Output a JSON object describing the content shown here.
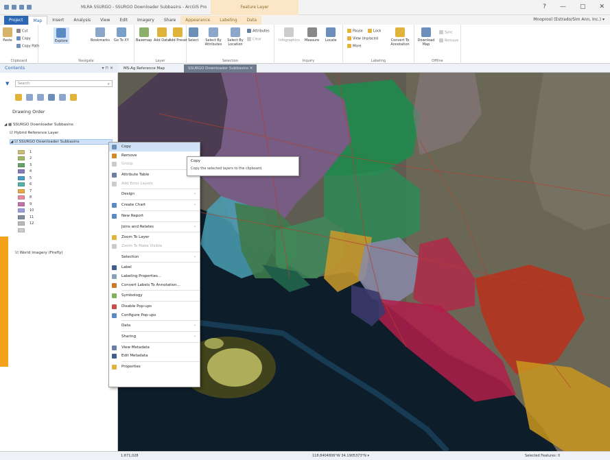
{
  "app": {
    "title": "MLRA SSURGO - SSURGO Downloader Subbasins - ArcGIS Pro",
    "contextual_tab_group": "Feature Layer",
    "window_controls": [
      "?",
      "—",
      "▢",
      "✕"
    ],
    "user": "Mnoprool (Estrado/Sim Ann, Inc.) ▾"
  },
  "ribbon_tabs": [
    "Project",
    "Map",
    "Insert",
    "Analysis",
    "View",
    "Edit",
    "Imagery",
    "Share",
    "Appearance",
    "Labeling",
    "Data"
  ],
  "ribbon": {
    "clipboard": {
      "label": "Clipboard",
      "paste": "Paste",
      "cut": "Cut",
      "copy": "Copy",
      "copy_path": "Copy Path"
    },
    "navigate": {
      "label": "Navigate",
      "explore": "Explore",
      "bookmarks": "Bookmarks",
      "goto": "Go To XY"
    },
    "layer": {
      "label": "Layer",
      "basemap": "Basemap",
      "add_data": "Add Data",
      "add_preset": "Add Preset"
    },
    "selection": {
      "label": "Selection",
      "select": "Select",
      "by_attributes": "Select By Attributes",
      "by_location": "Select By Location",
      "attributes": "Attributes",
      "clear": "Clear"
    },
    "inquiry": {
      "label": "Inquiry",
      "infographics": "Infographics",
      "measure": "Measure",
      "locate": "Locate"
    },
    "labeling": {
      "label": "Labeling",
      "pause": "Pause",
      "lock": "Lock",
      "view_unplaced": "View Unplaced",
      "more": "More",
      "convert": "Convert To Annotation"
    },
    "offline": {
      "label": "Offline",
      "download": "Download Map",
      "sync": "Sync",
      "remove": "Remove"
    }
  },
  "contents": {
    "title": "Contents",
    "controls": "▾ ⊓ ✕",
    "search_placeholder": "Search",
    "heading": "Drawing Order",
    "map_name": "SSURGO Downloader Subbasins",
    "hybrid_layer": "Hybrid Reference Layer",
    "selected_layer": "SSURGO Downloader Subbasins",
    "legend": [
      {
        "label": "1",
        "color": "#c9bd7a"
      },
      {
        "label": "2",
        "color": "#a3b869"
      },
      {
        "label": "3",
        "color": "#67a36b"
      },
      {
        "label": "4",
        "color": "#8b7ab8"
      },
      {
        "label": "5",
        "color": "#4a9cc6"
      },
      {
        "label": "6",
        "color": "#56b0a8"
      },
      {
        "label": "7",
        "color": "#e8a94a"
      },
      {
        "label": "8",
        "color": "#e58aa2"
      },
      {
        "label": "9",
        "color": "#c273a8"
      },
      {
        "label": "10",
        "color": "#9aa0d6"
      },
      {
        "label": "11",
        "color": "#7f8f9c"
      },
      {
        "label": "12",
        "color": "#b9b9b9"
      },
      {
        "label": "",
        "color": "#cccccc"
      }
    ],
    "imagery_layer": "World Imagery (Firefly)"
  },
  "map_tabs": [
    "MS-Ag Reference Map",
    "SSURGO Downloader Subbasins ✕"
  ],
  "context_menu": [
    {
      "label": "Copy",
      "icon": "copy-icon",
      "color": "#6b8fb8"
    },
    {
      "label": "Remove",
      "icon": "remove-icon",
      "color": "#d08a2a"
    },
    {
      "label": "Group",
      "icon": "group-icon",
      "color": "#cccccc"
    },
    {
      "sep": true
    },
    {
      "label": "Attribute Table",
      "icon": "table-icon",
      "color": "#6b7fa3"
    },
    {
      "label": "Add Error Layers",
      "icon": "error-layers-icon",
      "color": "#cccccc"
    },
    {
      "sep": true
    },
    {
      "label": "Design",
      "icon": "",
      "color": "",
      "arrow": true
    },
    {
      "sep": true
    },
    {
      "label": "Create Chart",
      "icon": "chart-icon",
      "color": "#5b8ac2",
      "arrow": true
    },
    {
      "sep": true
    },
    {
      "label": "New Report",
      "icon": "report-icon",
      "color": "#5b8ac2"
    },
    {
      "sep": true
    },
    {
      "label": "Joins and Relates",
      "icon": "",
      "color": "",
      "arrow": true
    },
    {
      "sep": true
    },
    {
      "label": "Zoom To Layer",
      "icon": "zoom-layer-icon",
      "color": "#e0b43c"
    },
    {
      "label": "Zoom To Make Visible",
      "icon": "zoom-visible-icon",
      "color": "#cccccc"
    },
    {
      "sep": true
    },
    {
      "label": "Selection",
      "icon": "",
      "color": "",
      "arrow": true
    },
    {
      "sep": true
    },
    {
      "label": "Label",
      "icon": "label-icon",
      "color": "#3f5f8a"
    },
    {
      "label": "Labeling Properties...",
      "icon": "labeling-props-icon",
      "color": "#8a9fb8"
    },
    {
      "label": "Convert Labels To Annotation...",
      "icon": "convert-labels-icon",
      "color": "#c87a2a"
    },
    {
      "sep": true
    },
    {
      "label": "Symbology",
      "icon": "symbology-icon",
      "color": "#7fb05a"
    },
    {
      "sep": true
    },
    {
      "label": "Disable Pop-ups",
      "icon": "popup-off-icon",
      "color": "#c8504a"
    },
    {
      "label": "Configure Pop-ups",
      "icon": "popup-config-icon",
      "color": "#5b8ac2"
    },
    {
      "sep": true
    },
    {
      "label": "Data",
      "icon": "",
      "color": "",
      "arrow": true
    },
    {
      "sep": true
    },
    {
      "label": "Sharing",
      "icon": "",
      "color": "",
      "arrow": true
    },
    {
      "sep": true
    },
    {
      "label": "View Metadata",
      "icon": "view-metadata-icon",
      "color": "#6b7fa3"
    },
    {
      "label": "Edit Metadata",
      "icon": "edit-metadata-icon",
      "color": "#3f5f8a"
    },
    {
      "sep": true
    },
    {
      "label": "Properties",
      "icon": "properties-icon",
      "color": "#e0b43c"
    }
  ],
  "tooltip": {
    "title": "Copy",
    "description": "Copy the selected layers to the clipboard."
  },
  "status": {
    "scale": "1:671,028",
    "coords": "118.8404806°W 34.1905373°N ▾",
    "selected": "Selected Features: 0"
  }
}
